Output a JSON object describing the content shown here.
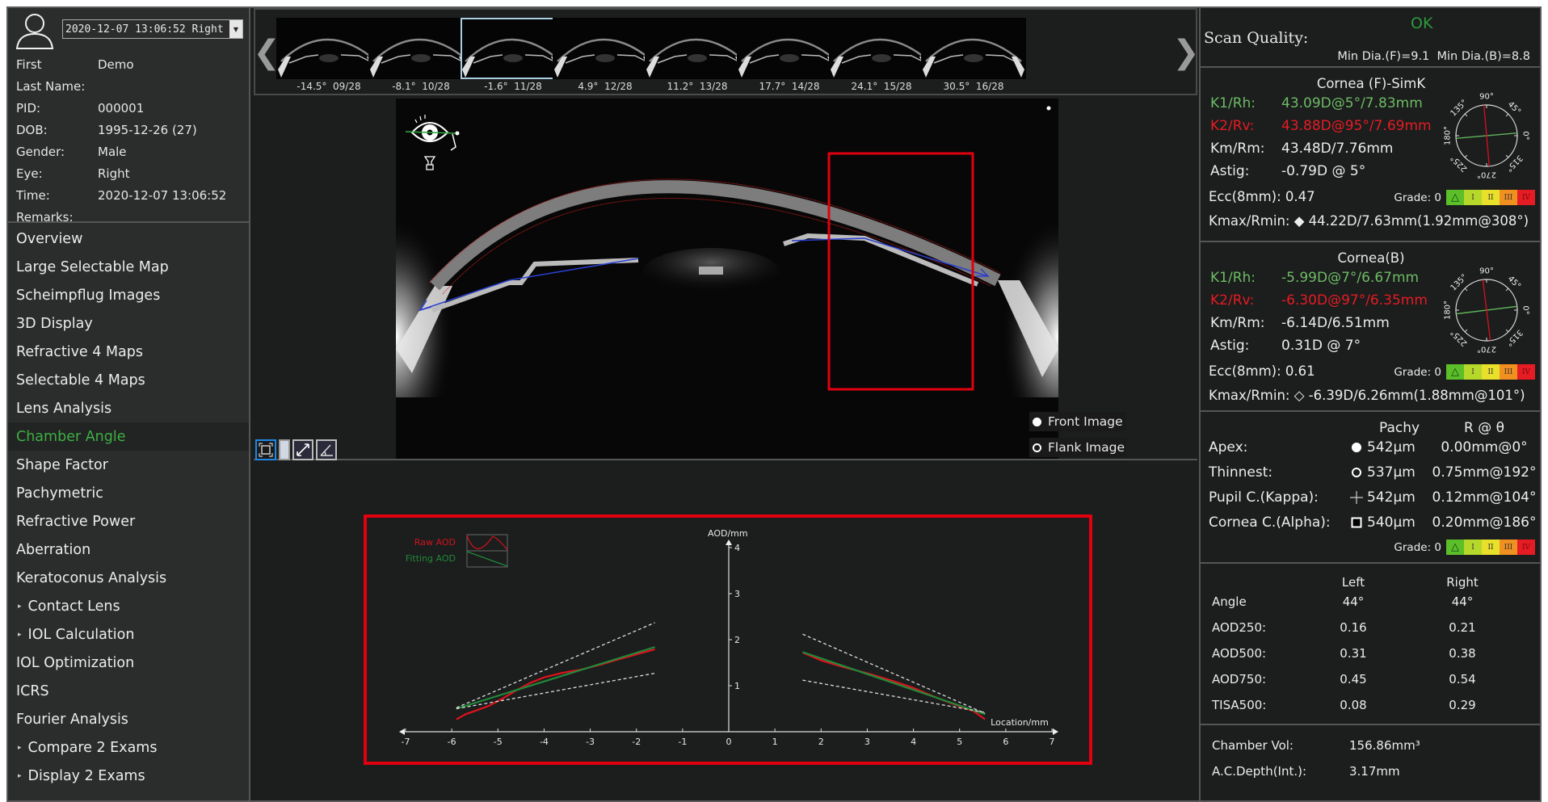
{
  "exam_selector": {
    "value": "2020-12-07 13:06:52 Right"
  },
  "patient": {
    "fields": [
      {
        "label": "First",
        "value": "Demo"
      },
      {
        "label": "Last Name:",
        "value": ""
      },
      {
        "label": "PID:",
        "value": "000001"
      },
      {
        "label": "DOB:",
        "value": "1995-12-26  (27)"
      },
      {
        "label": "Gender:",
        "value": "Male"
      },
      {
        "label": "Eye:",
        "value": "Right"
      },
      {
        "label": "Time:",
        "value": "2020-12-07 13:06:52"
      },
      {
        "label": "Remarks:",
        "value": ""
      }
    ]
  },
  "nav": {
    "items": [
      {
        "label": "Overview",
        "expandable": false,
        "active": false
      },
      {
        "label": "Large Selectable Map",
        "expandable": false,
        "active": false
      },
      {
        "label": "Scheimpflug Images",
        "expandable": false,
        "active": false
      },
      {
        "label": "3D Display",
        "expandable": false,
        "active": false
      },
      {
        "label": "Refractive 4 Maps",
        "expandable": false,
        "active": false
      },
      {
        "label": "Selectable 4 Maps",
        "expandable": false,
        "active": false
      },
      {
        "label": "Lens Analysis",
        "expandable": false,
        "active": false
      },
      {
        "label": "Chamber Angle",
        "expandable": false,
        "active": true
      },
      {
        "label": "Shape Factor",
        "expandable": false,
        "active": false
      },
      {
        "label": "Pachymetric",
        "expandable": false,
        "active": false
      },
      {
        "label": "Refractive Power",
        "expandable": false,
        "active": false
      },
      {
        "label": "Aberration",
        "expandable": false,
        "active": false
      },
      {
        "label": "Keratoconus Analysis",
        "expandable": false,
        "active": false
      },
      {
        "label": "Contact Lens",
        "expandable": true,
        "active": false
      },
      {
        "label": "IOL Calculation",
        "expandable": true,
        "active": false
      },
      {
        "label": "IOL Optimization",
        "expandable": false,
        "active": false
      },
      {
        "label": "ICRS",
        "expandable": false,
        "active": false
      },
      {
        "label": "Fourier Analysis",
        "expandable": false,
        "active": false
      },
      {
        "label": "Compare 2 Exams",
        "expandable": true,
        "active": false
      },
      {
        "label": "Display 2 Exams",
        "expandable": true,
        "active": false
      }
    ]
  },
  "thumbnails": {
    "prev_icon": "chevron-left-icon",
    "next_icon": "chevron-right-icon",
    "items": [
      {
        "angle": "-14.5°",
        "index": "09/28",
        "selected": false
      },
      {
        "angle": "-8.1°",
        "index": "10/28",
        "selected": false
      },
      {
        "angle": "-1.6°",
        "index": "11/28",
        "selected": true
      },
      {
        "angle": "4.9°",
        "index": "12/28",
        "selected": false
      },
      {
        "angle": "11.2°",
        "index": "13/28",
        "selected": false
      },
      {
        "angle": "17.7°",
        "index": "14/28",
        "selected": false
      },
      {
        "angle": "24.1°",
        "index": "15/28",
        "selected": false
      },
      {
        "angle": "30.5°",
        "index": "16/28",
        "selected": false
      }
    ]
  },
  "scan_view": {
    "image_modes": [
      {
        "label": "Front Image",
        "selected": true
      },
      {
        "label": "Flank Image",
        "selected": false
      }
    ],
    "tools": [
      "fit-view-icon",
      "panel-toggle-icon",
      "measure-distance-icon",
      "measure-angle-icon"
    ]
  },
  "right": {
    "scan_quality": {
      "label": "Scan Quality:",
      "status": "OK",
      "min_dia": "Min Dia.(F)=9.1  Min Dia.(B)=8.8"
    },
    "cornea_front": {
      "title": "Cornea (F)-SimK",
      "k1_label": "K1/Rh:",
      "k1": "43.09D@5°/7.83mm",
      "k2_label": "K2/Rv:",
      "k2": "43.88D@95°/7.69mm",
      "km_label": "Km/Rm:",
      "km": "43.48D/7.76mm",
      "astig_label": "Astig:",
      "astig": "-0.79D @ 5°",
      "ecc_label": "Ecc(8mm):",
      "ecc": "0.47",
      "grade": "Grade: 0",
      "kmax_label": "Kmax/Rmin:",
      "kmax_symbol": "◆",
      "kmax": "44.22D/7.63mm(1.92mm@308°)",
      "k1_axis_deg": 5,
      "k2_axis_deg": 95
    },
    "cornea_back": {
      "title": "Cornea(B)",
      "k1_label": "K1/Rh:",
      "k1": "-5.99D@7°/6.67mm",
      "k2_label": "K2/Rv:",
      "k2": "-6.30D@97°/6.35mm",
      "km_label": "Km/Rm:",
      "km": "-6.14D/6.51mm",
      "astig_label": "Astig:",
      "astig": "0.31D @ 7°",
      "ecc_label": "Ecc(8mm):",
      "ecc": "0.61",
      "grade": "Grade: 0",
      "kmax_label": "Kmax/Rmin:",
      "kmax_symbol": "◇",
      "kmax": "-6.39D/6.26mm(1.88mm@101°)",
      "k1_axis_deg": 7,
      "k2_axis_deg": 97
    },
    "dial_labels": [
      "90°",
      "45°",
      "0°",
      "315°",
      "270°",
      "225°",
      "180°",
      "135°"
    ],
    "grade_scale": [
      "△",
      "I",
      "II",
      "III",
      "IV"
    ],
    "grade_colors": [
      "#5cbf2a",
      "#b6d82a",
      "#e8e02a",
      "#f09020",
      "#e51c23"
    ],
    "pachy": {
      "header_pachy": "Pachy",
      "header_r": "R @ θ",
      "rows": [
        {
          "label": "Apex:",
          "symbol": "filled-circle",
          "pachy": "542µm",
          "r": "0.00mm@0°"
        },
        {
          "label": "Thinnest:",
          "symbol": "open-circle",
          "pachy": "537µm",
          "r": "0.75mm@192°"
        },
        {
          "label": "Pupil C.(Kappa):",
          "symbol": "crosshair",
          "pachy": "542µm",
          "r": "0.12mm@104°"
        },
        {
          "label": "Cornea C.(Alpha):",
          "symbol": "square",
          "pachy": "540µm",
          "r": "0.20mm@186°"
        }
      ],
      "grade": "Grade: 0"
    },
    "angle": {
      "header_left": "Left",
      "header_right": "Right",
      "rows": [
        {
          "label": "Angle",
          "left": "44°",
          "right": "44°"
        },
        {
          "label": "AOD250:",
          "left": "0.16",
          "right": "0.21"
        },
        {
          "label": "AOD500:",
          "left": "0.31",
          "right": "0.38"
        },
        {
          "label": "AOD750:",
          "left": "0.45",
          "right": "0.54"
        },
        {
          "label": "TISA500:",
          "left": "0.08",
          "right": "0.29"
        }
      ]
    },
    "chamber": {
      "vol_label": "Chamber Vol:",
      "vol": "156.86mm³",
      "depth_label": "A.C.Depth(Int.):",
      "depth": "3.17mm"
    }
  },
  "chart_data": {
    "type": "line",
    "title": "",
    "xlabel": "Location/mm",
    "ylabel": "AOD/mm",
    "xlim": [
      -7,
      7
    ],
    "ylim": [
      0,
      4
    ],
    "xticks": [
      -7,
      -6,
      -5,
      -4,
      -3,
      -2,
      -1,
      0,
      1,
      2,
      3,
      4,
      5,
      6,
      7
    ],
    "yticks": [
      1,
      2,
      3,
      4
    ],
    "grid": false,
    "legend": {
      "placement": "top-left",
      "entries": [
        {
          "name": "Raw AOD",
          "color": "#d0131d"
        },
        {
          "name": "Fitting AOD",
          "color": "#1f8a3a"
        }
      ]
    },
    "series": [
      {
        "name": "Raw AOD (left)",
        "color": "#e0131d",
        "x": [
          -5.9,
          -5.7,
          -5.5,
          -5.2,
          -4.9,
          -4.6,
          -4.3,
          -4.0,
          -3.6,
          -3.2,
          -2.8,
          -2.4,
          -2.0,
          -1.6
        ],
        "y": [
          0.27,
          0.38,
          0.45,
          0.56,
          0.72,
          0.9,
          1.06,
          1.18,
          1.28,
          1.35,
          1.45,
          1.57,
          1.68,
          1.79
        ]
      },
      {
        "name": "Fitting AOD (left)",
        "color": "#1f8a3a",
        "x": [
          -5.9,
          -1.6
        ],
        "y": [
          0.5,
          1.84
        ]
      },
      {
        "name": "Raw AOD (right)",
        "color": "#e0131d",
        "x": [
          1.6,
          2.0,
          2.5,
          3.0,
          3.5,
          4.0,
          4.5,
          5.0,
          5.3,
          5.55
        ],
        "y": [
          1.72,
          1.55,
          1.4,
          1.27,
          1.12,
          0.95,
          0.74,
          0.55,
          0.45,
          0.27
        ]
      },
      {
        "name": "Fitting AOD (right)",
        "color": "#1f8a3a",
        "x": [
          1.6,
          5.55
        ],
        "y": [
          1.73,
          0.38
        ]
      },
      {
        "name": "Upper bound (left)",
        "color": "#dddddd",
        "dashed": true,
        "x": [
          -5.9,
          -1.6
        ],
        "y": [
          0.52,
          2.37
        ]
      },
      {
        "name": "Lower bound (left)",
        "color": "#dddddd",
        "dashed": true,
        "x": [
          -5.9,
          -1.6
        ],
        "y": [
          0.5,
          1.27
        ]
      },
      {
        "name": "Upper bound (right)",
        "color": "#dddddd",
        "dashed": true,
        "x": [
          1.6,
          5.55
        ],
        "y": [
          2.12,
          0.4
        ]
      },
      {
        "name": "Lower bound (right)",
        "color": "#dddddd",
        "dashed": true,
        "x": [
          1.6,
          5.55
        ],
        "y": [
          1.12,
          0.42
        ]
      }
    ]
  }
}
